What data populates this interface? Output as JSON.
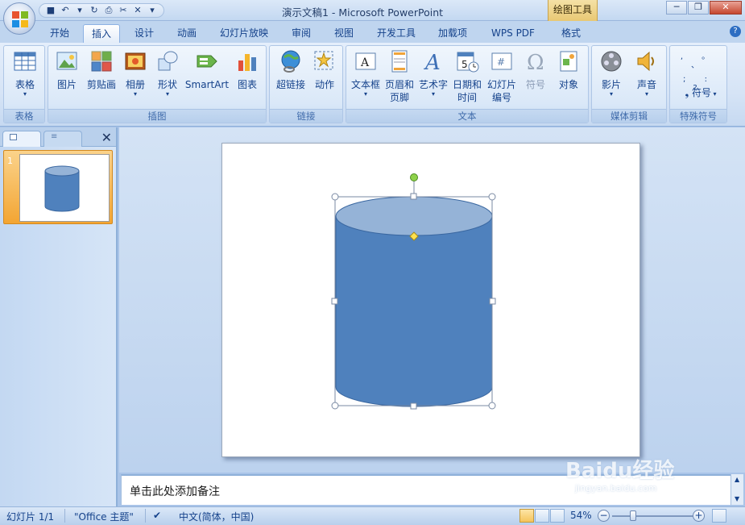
{
  "window": {
    "title": "演示文稿1 - Microsoft PowerPoint",
    "contextual_tab": "绘图工具",
    "buttons": [
      "minimize",
      "maximize",
      "close"
    ]
  },
  "tabs": [
    {
      "label": "开始",
      "active": false
    },
    {
      "label": "插入",
      "active": true
    },
    {
      "label": "设计",
      "active": false
    },
    {
      "label": "动画",
      "active": false
    },
    {
      "label": "幻灯片放映",
      "active": false
    },
    {
      "label": "审阅",
      "active": false
    },
    {
      "label": "视图",
      "active": false
    },
    {
      "label": "开发工具",
      "active": false
    },
    {
      "label": "加载项",
      "active": false
    },
    {
      "label": "WPS PDF",
      "active": false
    },
    {
      "label": "格式",
      "active": false
    }
  ],
  "ribbon": {
    "groups": [
      {
        "label": "表格",
        "buttons": [
          {
            "label": "表格",
            "icon": "table-icon"
          }
        ]
      },
      {
        "label": "插图",
        "buttons": [
          {
            "label": "图片",
            "icon": "picture-icon"
          },
          {
            "label": "剪贴画",
            "icon": "clipart-icon"
          },
          {
            "label": "相册",
            "icon": "album-icon"
          },
          {
            "label": "形状",
            "icon": "shapes-icon"
          },
          {
            "label": "SmartArt",
            "icon": "smartart-icon"
          },
          {
            "label": "图表",
            "icon": "chart-icon"
          }
        ]
      },
      {
        "label": "链接",
        "buttons": [
          {
            "label": "超链接",
            "icon": "hyperlink-icon"
          },
          {
            "label": "动作",
            "icon": "action-icon"
          }
        ]
      },
      {
        "label": "文本",
        "buttons": [
          {
            "label": "文本框",
            "icon": "textbox-icon"
          },
          {
            "label": "页眉和页脚",
            "icon": "header-footer-icon"
          },
          {
            "label": "艺术字",
            "icon": "wordart-icon"
          },
          {
            "label": "日期和时间",
            "icon": "datetime-icon"
          },
          {
            "label": "幻灯片编号",
            "icon": "slide-number-icon"
          },
          {
            "label": "符号",
            "icon": "omega-icon"
          },
          {
            "label": "对象",
            "icon": "object-icon"
          }
        ]
      },
      {
        "label": "媒体剪辑",
        "buttons": [
          {
            "label": "影片",
            "icon": "movie-icon"
          },
          {
            "label": "声音",
            "icon": "sound-icon"
          }
        ]
      },
      {
        "label": "特殊符号",
        "buttons": [
          {
            "label": "符号",
            "icon": "special-symbol-icon"
          }
        ]
      }
    ]
  },
  "slides_panel": {
    "slide_number": "1"
  },
  "notes": {
    "placeholder": "单击此处添加备注"
  },
  "statusbar": {
    "slide_info": "幻灯片 1/1",
    "theme": "\"Office 主题\"",
    "language": "中文(简体，中国)",
    "zoom": "54%"
  },
  "watermark": {
    "text": "Baidu经验",
    "url": "jingyan.baidu.com"
  },
  "colors": {
    "cylinder_fill": "#4f81bd",
    "cylinder_top": "#95b3d7",
    "selection_handle": "#ffffff",
    "rotation_handle": "#8ed24a",
    "adjust_handle": "#ffe14f"
  }
}
